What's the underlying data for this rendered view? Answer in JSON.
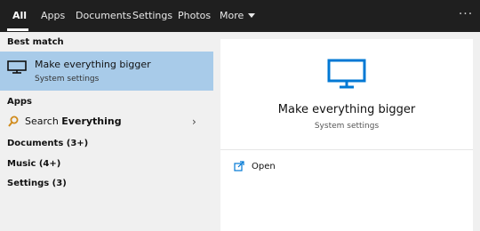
{
  "tabs": [
    {
      "label": "All"
    },
    {
      "label": "Apps"
    },
    {
      "label": "Documents"
    },
    {
      "label": "Settings"
    },
    {
      "label": "Photos"
    },
    {
      "label": "More"
    }
  ],
  "more_options_icon": "ellipsis-icon",
  "results": {
    "best_match_header": "Best match",
    "best_match": {
      "title": "Make everything bigger",
      "subtitle": "System settings",
      "icon": "monitor-icon"
    },
    "apps_header": "Apps",
    "app_search": {
      "prefix": "Search ",
      "query": "Everything",
      "icon": "search-icon"
    },
    "categories": [
      "Documents (3+)",
      "Music (4+)",
      "Settings (3)"
    ]
  },
  "detail": {
    "title": "Make everything bigger",
    "subtitle": "System settings",
    "open_label": "Open",
    "icon": "monitor-icon"
  },
  "colors": {
    "topbar": "#1f1f1f",
    "selected_row": "#a8cbe9",
    "accent": "#0078d4",
    "search_icon": "#d08a1a"
  }
}
